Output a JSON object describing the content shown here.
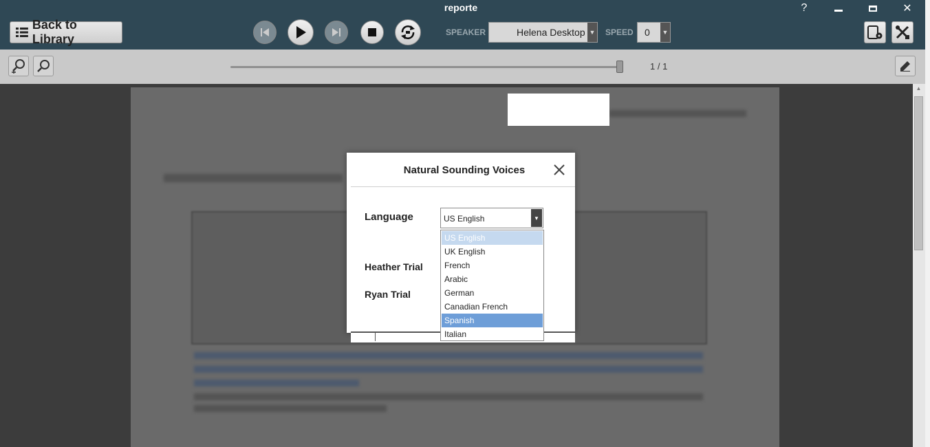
{
  "window": {
    "title": "reporte",
    "help_label": "?",
    "minimize_label": "–",
    "maximize_label": "□",
    "close_label": "✕"
  },
  "toolbar": {
    "back_label": "Back to Library",
    "speaker_label": "SPEAKER",
    "speaker_value": "Helena Desktop",
    "speed_label": "SPEED",
    "speed_value": "0"
  },
  "viewer": {
    "page_count": "1 / 1",
    "progress": 1.0
  },
  "dialog": {
    "title": "Natural Sounding Voices",
    "language_label": "Language",
    "language_value": "US English",
    "voices": [
      "Heather Trial",
      "Ryan Trial"
    ],
    "language_options": [
      "US English",
      "UK English",
      "French",
      "Arabic",
      "German",
      "Canadian French",
      "Spanish",
      "Italian"
    ],
    "selected_option": "US English",
    "hovered_option": "Spanish"
  },
  "icons": {
    "back": "list-icon",
    "prev": "skip-back-icon",
    "play": "play-icon",
    "next": "skip-forward-icon",
    "stop": "stop-icon",
    "repeat": "repeat-icon",
    "device": "device-settings-icon",
    "tools": "tools-icon",
    "zoom_in": "zoom-in-icon",
    "zoom_out": "zoom-out-icon",
    "edit": "pencil-icon",
    "dialog_close": "close-icon"
  },
  "colors": {
    "titlebar": "#2f4855",
    "highlight": "#6e9ed8",
    "selected": "#c5d9ef"
  }
}
